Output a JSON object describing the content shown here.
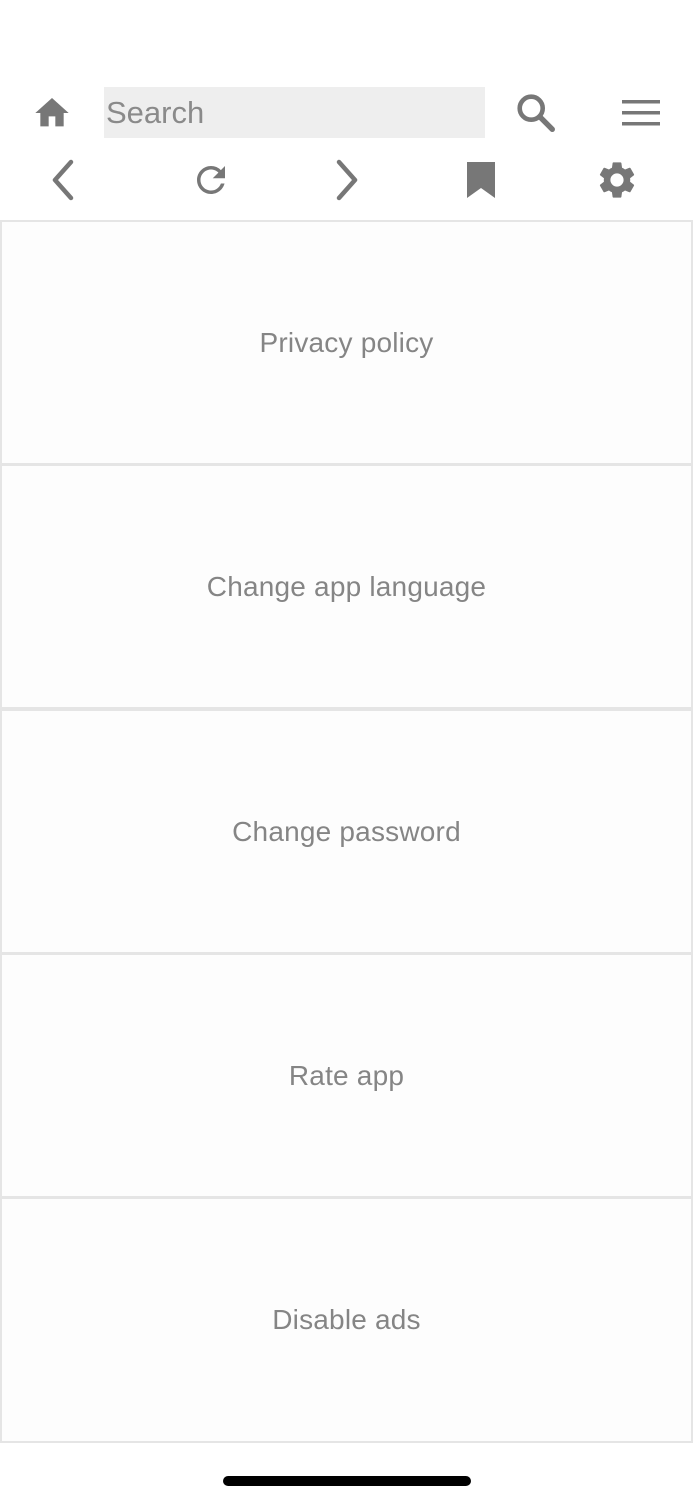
{
  "header": {
    "home_icon": "home-icon",
    "search": {
      "placeholder": "Search",
      "value": ""
    },
    "search_icon": "search-icon",
    "menu_icon": "hamburger-menu-icon"
  },
  "nav": {
    "icons": [
      "chevron-left-icon",
      "refresh-icon",
      "chevron-right-icon",
      "bookmark-icon",
      "gear-icon"
    ]
  },
  "settings_menu": {
    "items": [
      {
        "label": "Privacy policy"
      },
      {
        "label": "Change app language"
      },
      {
        "label": "Change password"
      },
      {
        "label": "Rate app"
      },
      {
        "label": "Disable ads"
      }
    ]
  },
  "colors": {
    "icon": "#777777",
    "search_background": "#eeeeee",
    "divider": "#e5e5e5",
    "label": "#858585"
  }
}
